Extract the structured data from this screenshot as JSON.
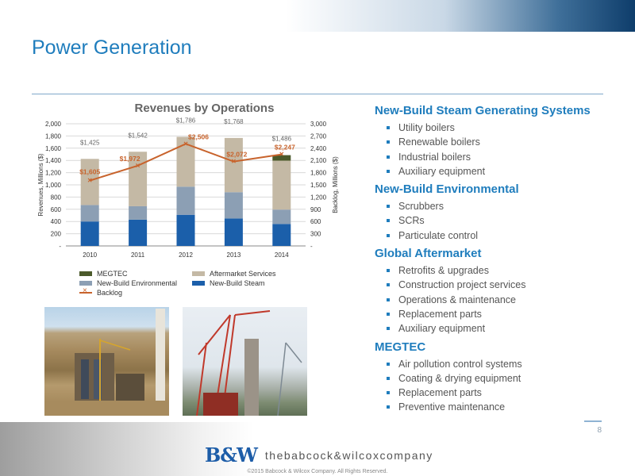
{
  "page": {
    "title": "Power Generation",
    "number": "8"
  },
  "chart_data": {
    "type": "bar",
    "title": "Revenues by Operations",
    "categories": [
      "2010",
      "2011",
      "2012",
      "2013",
      "2014"
    ],
    "series": [
      {
        "name": "New-Build Steam",
        "values": [
          400,
          430,
          510,
          450,
          360
        ],
        "color": "#1b5faa"
      },
      {
        "name": "New-Build Environmental",
        "values": [
          270,
          220,
          460,
          430,
          235
        ],
        "color": "#8c9fb4"
      },
      {
        "name": "Aftermarket Services",
        "values": [
          755,
          892,
          816,
          888,
          801
        ],
        "color": "#c4b9a5"
      },
      {
        "name": "MEGTEC",
        "values": [
          0,
          0,
          0,
          0,
          90
        ],
        "color": "#4b5a2b"
      }
    ],
    "totals": [
      1425,
      1542,
      1786,
      1768,
      1486
    ],
    "total_labels": [
      "$1,425",
      "$1,542",
      "$1,786",
      "$1,768",
      "$1,486"
    ],
    "backlog": {
      "name": "Backlog",
      "values": [
        1605,
        1972,
        2506,
        2072,
        2247
      ],
      "labels": [
        "$1,605",
        "$1,972",
        "$2,506",
        "$2,072",
        "$2,247"
      ],
      "color": "#c8632c"
    },
    "ylabel": "Revenues, Millions ($)",
    "y2label": "Backlog, Millions ($)",
    "ylim": [
      0,
      2000
    ],
    "y2lim": [
      0,
      3000
    ],
    "yticks": [
      "-",
      "200",
      "400",
      "600",
      "800",
      "1,000",
      "1,200",
      "1,400",
      "1,600",
      "1,800",
      "2,000"
    ],
    "y2ticks": [
      "-",
      "300",
      "600",
      "900",
      "1,200",
      "1,500",
      "1,800",
      "2,100",
      "2,400",
      "2,700",
      "3,000"
    ],
    "legend": {
      "placement": "bottom",
      "items": [
        "MEGTEC",
        "Aftermarket Services",
        "New-Build Environmental",
        "New-Build Steam",
        "Backlog"
      ]
    }
  },
  "sections": [
    {
      "title": "New-Build Steam Generating Systems",
      "items": [
        "Utility boilers",
        "Renewable boilers",
        "Industrial boilers",
        "Auxiliary equipment"
      ]
    },
    {
      "title": "New-Build Environmental",
      "items": [
        "Scrubbers",
        "SCRs",
        "Particulate control"
      ]
    },
    {
      "title": "Global Aftermarket",
      "items": [
        "Retrofits & upgrades",
        "Construction project services",
        "Operations & maintenance",
        "Replacement parts",
        "Auxiliary equipment"
      ]
    },
    {
      "title": "MEGTEC",
      "items": [
        "Air pollution control systems",
        "Coating & drying equipment",
        "Replacement parts",
        "Preventive maintenance"
      ]
    }
  ],
  "footer": {
    "logo_mark": "B&W",
    "logo_text": "thebabcock&wilcoxcompany",
    "copyright": "©2015 Babcock & Wilcox Company. All Rights Reserved."
  }
}
